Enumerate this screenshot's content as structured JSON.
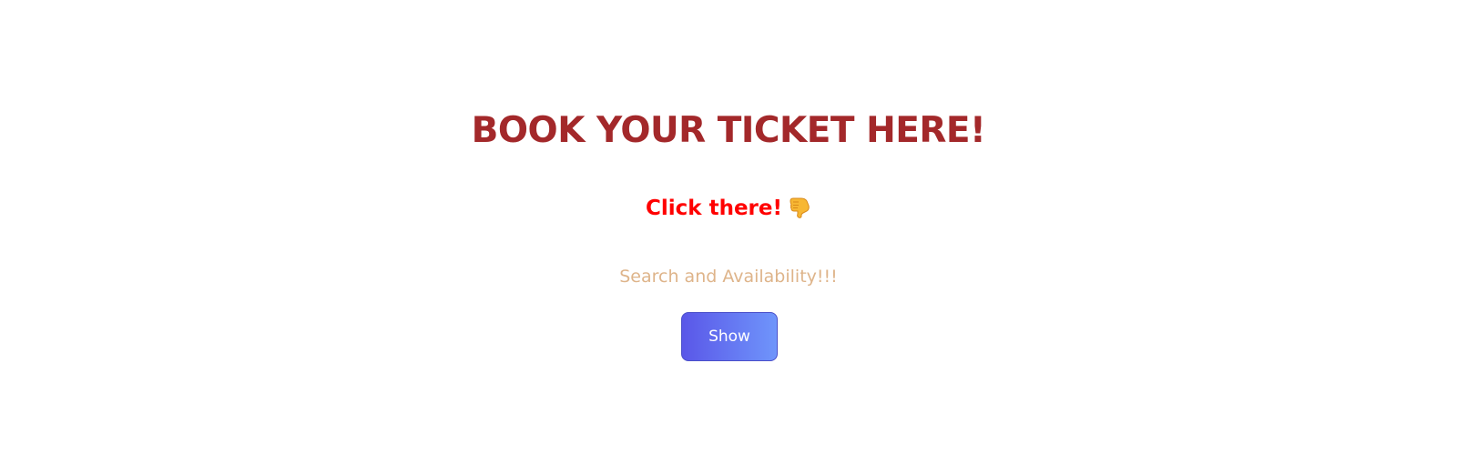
{
  "heading": {
    "text": "BOOK YOUR TICKET HERE!",
    "color": "#a3282a"
  },
  "prompt": {
    "text": "Click there!",
    "color": "#ff0000",
    "icon": "pointing-down-hand-icon"
  },
  "caption": {
    "text": "Search and Availability!!!",
    "color": "#deb48a"
  },
  "action": {
    "label": "Show",
    "gradient_start": "#5a57e8",
    "gradient_end": "#6f95fb"
  }
}
